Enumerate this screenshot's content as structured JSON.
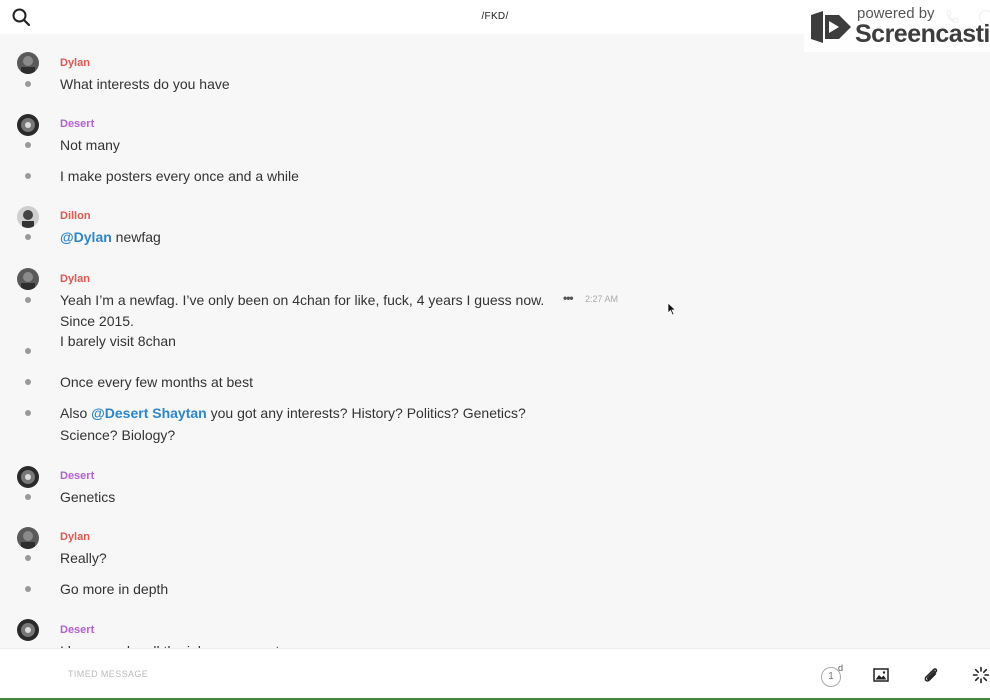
{
  "header": {
    "title": "/FKD/"
  },
  "watermark": {
    "powered": "powered by",
    "brand": "Screencastify"
  },
  "messages": [
    {
      "sender": "Dylan",
      "color": "#e0574f",
      "lines": [
        "What interests do you have"
      ]
    },
    {
      "sender": "Desert",
      "color": "#b560d0",
      "lines": [
        "Not many",
        "I make posters every once and a while"
      ]
    },
    {
      "sender": "Dillon",
      "color": "#e0574f",
      "lines": [
        "@Dylan",
        "newfag"
      ]
    },
    {
      "sender": "Dylan",
      "color": "#e0574f",
      "lines": [
        "Yeah I’m a newfag. I’ve only been on 4chan for like, fuck, 4 years I guess now.",
        "Since 2015.",
        "I barely visit 8chan",
        "Once every few months at best",
        "Also",
        "@Desert Shaytan",
        "you got any interests? History? Politics? Genetics?",
        "Science? Biology?"
      ],
      "time": "2:27 AM"
    },
    {
      "sender": "Desert",
      "color": "#b560d0",
      "lines": [
        "Genetics"
      ]
    },
    {
      "sender": "Dylan",
      "color": "#e0574f",
      "lines": [
        "Really?",
        "Go more in depth"
      ]
    },
    {
      "sender": "Desert",
      "color": "#b560d0",
      "lines": [
        "I know, make all the jokes you want"
      ]
    }
  ],
  "composer": {
    "placeholder": "TIMED MESSAGE",
    "timer_value": "1",
    "timer_unit": "d"
  },
  "icons": {
    "search": "search-icon",
    "phone": "phone-icon",
    "info": "info-icon",
    "more": "more-options-icon",
    "image": "image-icon",
    "attach": "paperclip-icon",
    "spinner": "loading-icon"
  }
}
